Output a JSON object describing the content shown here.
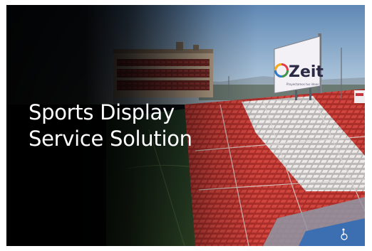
{
  "banner": {
    "headline_line1": "Sports Display",
    "headline_line2": "Service Solution"
  },
  "billboard": {
    "brand": "Zeit",
    "tagline": "Proyectamos tus ideas"
  },
  "colors": {
    "seat_red": "#b8322d",
    "seat_white": "#e9e6e4",
    "sky": "#8fb0cf",
    "pitch": "#2d4a2c",
    "billboard_bg": "#f4f2f7",
    "brand_text": "#2b2a45"
  },
  "icons": {
    "logo": "zeit-ring-logo-icon",
    "accessibility": "wheelchair-icon"
  }
}
